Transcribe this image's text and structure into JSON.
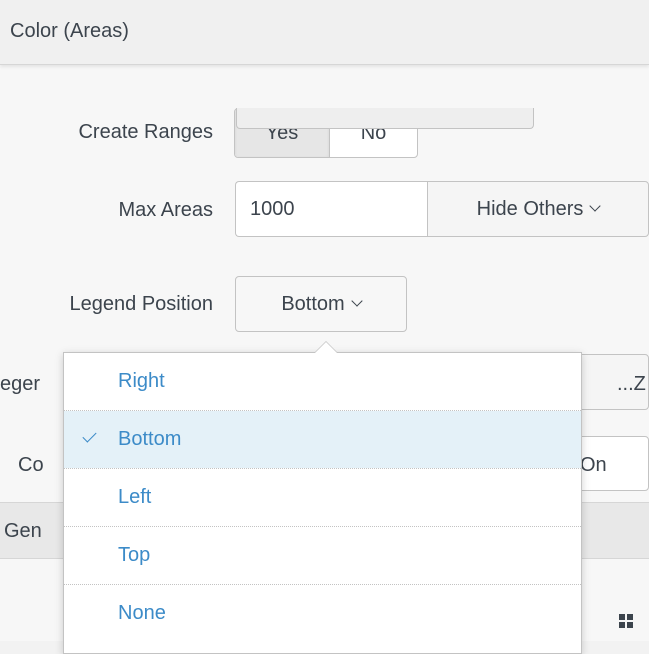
{
  "section": {
    "title": "Color (Areas)"
  },
  "create_ranges": {
    "label": "Create Ranges",
    "options": [
      "Yes",
      "No"
    ],
    "selected": "Yes"
  },
  "max_areas": {
    "label": "Max Areas",
    "value": "1000",
    "dropdown_label": "Hide Others"
  },
  "legend_position": {
    "label": "Legend Position",
    "value": "Bottom",
    "menu": [
      {
        "label": "Right",
        "selected": false
      },
      {
        "label": "Bottom",
        "selected": true
      },
      {
        "label": "Left",
        "selected": false
      },
      {
        "label": "Top",
        "selected": false
      },
      {
        "label": "None",
        "selected": false
      }
    ]
  },
  "background": {
    "row1_label_fragment": "eger",
    "row1_value_fragment": "...Z",
    "row2_label_fragment": "Co",
    "row2_value_fragment": "On",
    "row3_label_fragment": "Gen"
  },
  "colors": {
    "link": "#3c8bc8",
    "selected_bg": "#e4f1f8",
    "text": "#3c444d",
    "border": "#c3c3c3"
  },
  "icons": {
    "bottom_right": "grid-icon"
  }
}
